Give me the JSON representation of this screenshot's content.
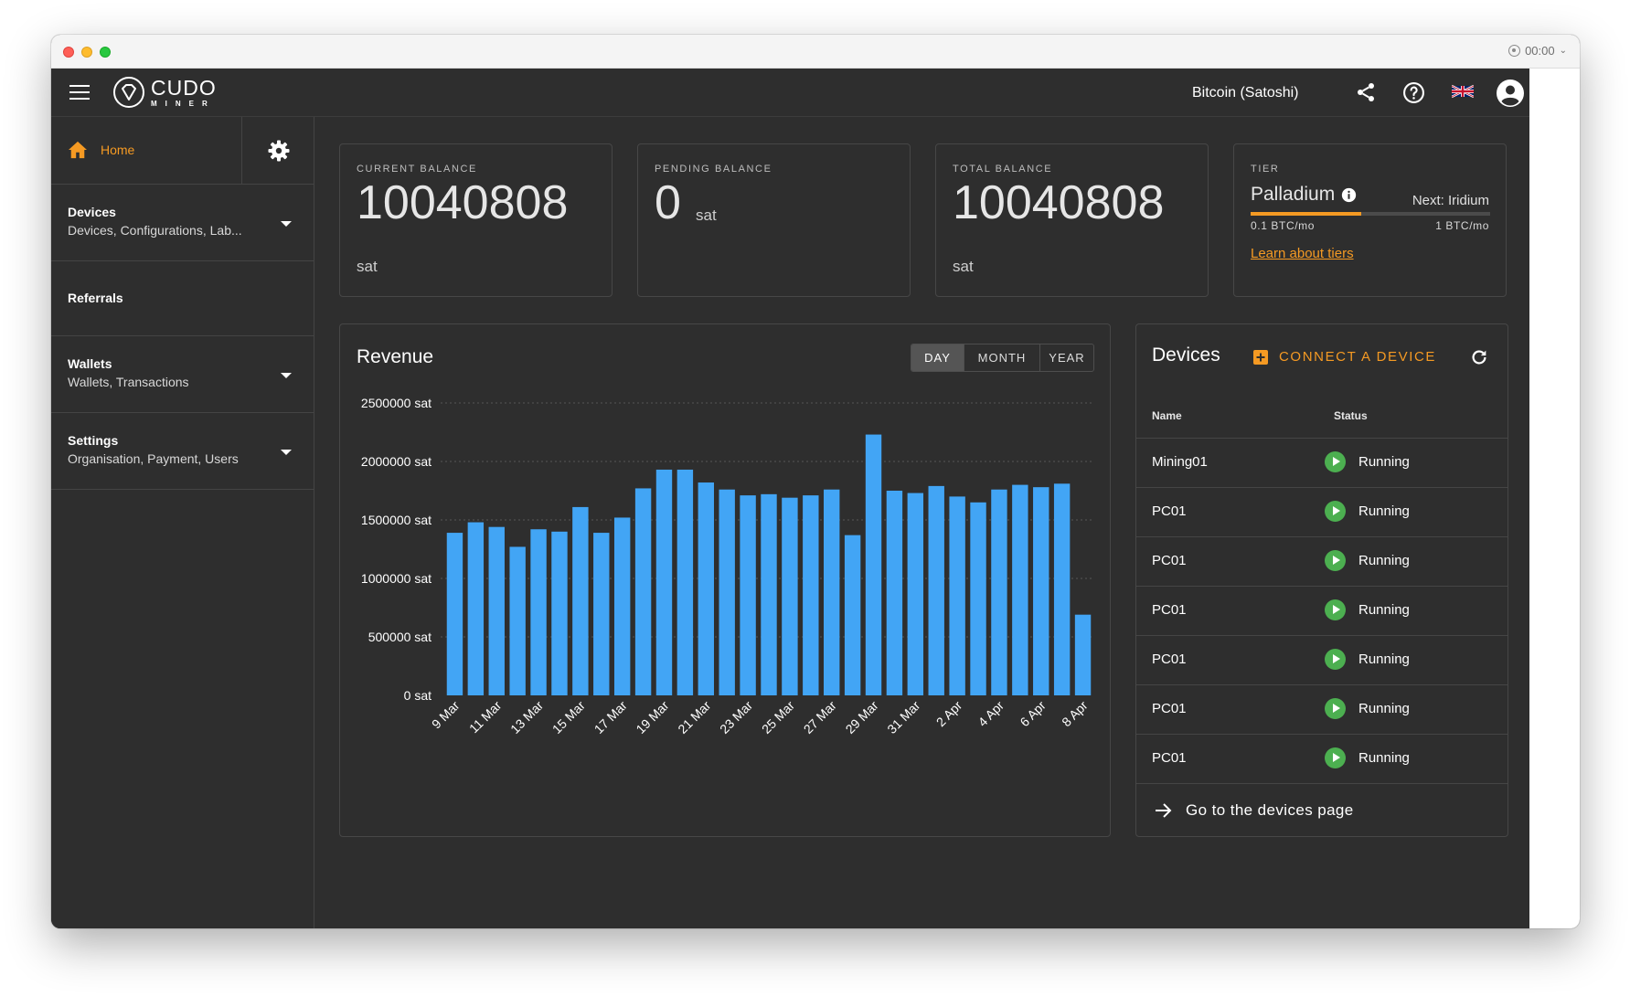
{
  "window": {
    "recording_time": "00:00"
  },
  "header": {
    "logo_text_top": "CUDO",
    "logo_text_bottom": "MINER",
    "currency": "Bitcoin (Satoshi)"
  },
  "sidebar": {
    "home_label": "Home",
    "items": [
      {
        "title": "Devices",
        "subtitle": "Devices, Configurations, Lab..."
      },
      {
        "title": "Referrals",
        "subtitle": ""
      },
      {
        "title": "Wallets",
        "subtitle": "Wallets, Transactions"
      },
      {
        "title": "Settings",
        "subtitle": "Organisation, Payment, Users"
      }
    ]
  },
  "balances": {
    "current": {
      "label": "CURRENT BALANCE",
      "value": "10040808",
      "unit": "sat"
    },
    "pending": {
      "label": "PENDING BALANCE",
      "value": "0",
      "unit": "sat"
    },
    "total": {
      "label": "TOTAL BALANCE",
      "value": "10040808",
      "unit": "sat"
    }
  },
  "tier": {
    "label": "TIER",
    "name": "Palladium",
    "next": "Next: Iridium",
    "min": "0.1 BTC/mo",
    "max": "1 BTC/mo",
    "progress": 0.46,
    "link": "Learn about tiers"
  },
  "revenue": {
    "title": "Revenue",
    "tabs": [
      "DAY",
      "MONTH",
      "YEAR"
    ],
    "active_tab": "DAY"
  },
  "chart_data": {
    "type": "bar",
    "title": "Revenue",
    "ylim": [
      0,
      2500000
    ],
    "yticks": [
      "0 sat",
      "500000 sat",
      "1000000 sat",
      "1500000 sat",
      "2000000 sat",
      "2500000 sat"
    ],
    "ytick_values": [
      0,
      500000,
      1000000,
      1500000,
      2000000,
      2500000
    ],
    "categories": [
      "9 Mar",
      "10 Mar",
      "11 Mar",
      "12 Mar",
      "13 Mar",
      "14 Mar",
      "15 Mar",
      "16 Mar",
      "17 Mar",
      "18 Mar",
      "19 Mar",
      "20 Mar",
      "21 Mar",
      "22 Mar",
      "23 Mar",
      "24 Mar",
      "25 Mar",
      "26 Mar",
      "27 Mar",
      "28 Mar",
      "29 Mar",
      "30 Mar",
      "31 Mar",
      "1 Apr",
      "2 Apr",
      "3 Apr",
      "4 Apr",
      "5 Apr",
      "6 Apr",
      "7 Apr",
      "8 Apr"
    ],
    "xtick_labels": [
      "9 Mar",
      "11 Mar",
      "13 Mar",
      "15 Mar",
      "17 Mar",
      "19 Mar",
      "21 Mar",
      "23 Mar",
      "25 Mar",
      "27 Mar",
      "29 Mar",
      "31 Mar",
      "2 Apr",
      "4 Apr",
      "6 Apr",
      "8 Apr"
    ],
    "values": [
      1390000,
      1480000,
      1440000,
      1270000,
      1420000,
      1400000,
      1610000,
      1390000,
      1520000,
      1770000,
      1930000,
      1930000,
      1820000,
      1760000,
      1710000,
      1720000,
      1690000,
      1710000,
      1760000,
      1370000,
      2230000,
      1750000,
      1730000,
      1790000,
      1700000,
      1650000,
      1760000,
      1800000,
      1780000,
      1810000,
      690000
    ],
    "color": "#42a5f5",
    "grid": true
  },
  "devices": {
    "title": "Devices",
    "connect_label": "CONNECT A DEVICE",
    "col_name": "Name",
    "col_status": "Status",
    "rows": [
      {
        "name": "Mining01",
        "status": "Running"
      },
      {
        "name": "PC01",
        "status": "Running"
      },
      {
        "name": "PC01",
        "status": "Running"
      },
      {
        "name": "PC01",
        "status": "Running"
      },
      {
        "name": "PC01",
        "status": "Running"
      },
      {
        "name": "PC01",
        "status": "Running"
      },
      {
        "name": "PC01",
        "status": "Running"
      }
    ],
    "footer_link": "Go to the devices page"
  },
  "colors": {
    "accent": "#f59a23",
    "bar": "#42a5f5",
    "running": "#4caf50",
    "background": "#2e2e2e"
  }
}
